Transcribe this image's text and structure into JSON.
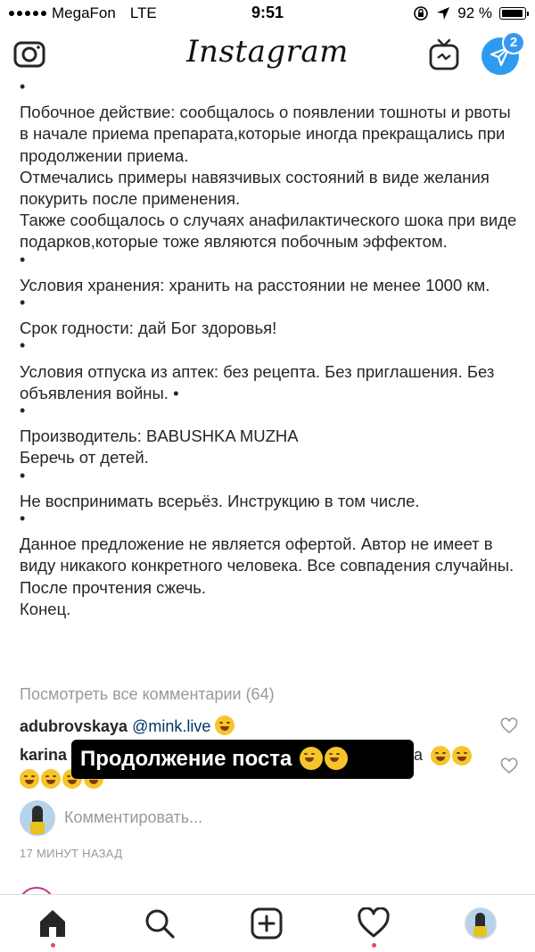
{
  "status_bar": {
    "carrier": "MegaFon",
    "network": "LTE",
    "time": "9:51",
    "battery": "92 %"
  },
  "header": {
    "logo": "Instagram",
    "direct_badge": "2"
  },
  "caption": {
    "bullet": "•",
    "paragraphs": [
      "Побочное действие: сообщалось о появлении тошноты и рвоты в начале приема препарата,которые иногда прекращались при продолжении приема.",
      "Отмечались примеры навязчивых состояний в виде желания покурить после применения.",
      "Также сообщалось о случаях анафилактического шока при виде подарков,которые тоже являются побочным эффектом.",
      "Условия хранения: хранить на расстоянии не менее 1000 км.",
      "Срок годности: дай Бог здоровья!",
      "Условия отпуска из аптек: без рецепта. Без приглашения. Без объявления войны. •",
      "Производитель: BABUSHKA MUZHA",
      "Беречь от детей.",
      "Не воспринимать всерьёз. Инструкцию в том числе.",
      "Данное предложение не является офертой. Автор не имеет в виду никакого конкретного человека. Все совпадения случайны. После прочтения сжечь.",
      "Конец."
    ]
  },
  "view_all_comments": "Посмотреть все комментарии (64)",
  "comments": [
    {
      "user": "adubrovskaya",
      "text": "@mink.live"
    },
    {
      "user": "karina",
      "text": "a"
    }
  ],
  "overlay_text": "Продолжение поста",
  "add_comment_placeholder": "Комментировать...",
  "time_ago": "17 МИНУТ НАЗАД",
  "tabs": [
    "home-icon",
    "search-icon",
    "add-icon",
    "activity-icon",
    "profile-icon"
  ],
  "colors": {
    "accent": "#3897f0",
    "notification": "#ed4956",
    "direct": "#2d9bf0"
  }
}
